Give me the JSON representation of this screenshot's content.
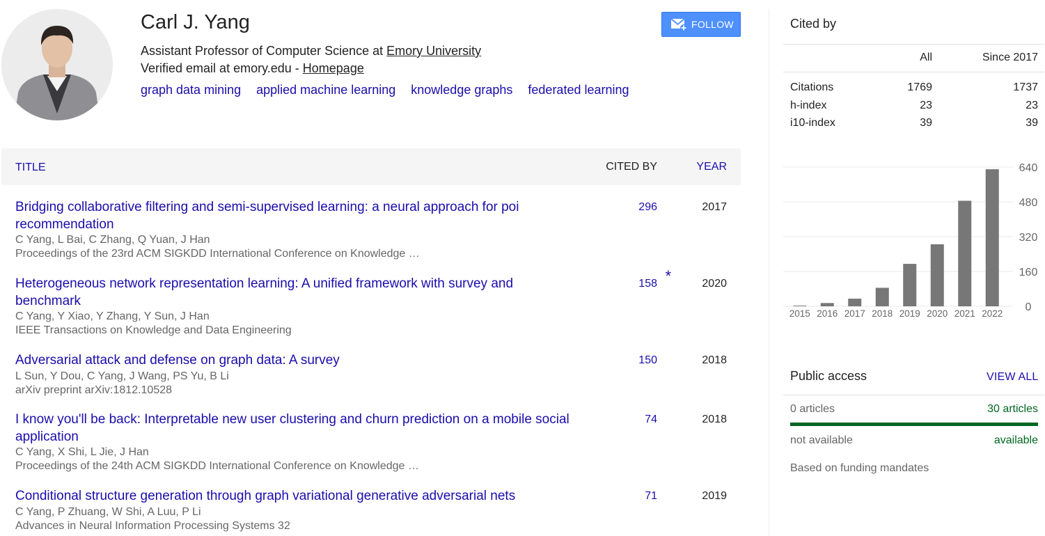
{
  "profile": {
    "name": "Carl J. Yang",
    "affiliation_prefix": "Assistant Professor of Computer Science at ",
    "affiliation_link": "Emory University",
    "email_prefix": "Verified email at emory.edu - ",
    "homepage_link": "Homepage",
    "interests": [
      "graph data mining",
      "applied machine learning",
      "knowledge graphs",
      "federated learning"
    ],
    "follow_label": "FOLLOW"
  },
  "table": {
    "col_title": "TITLE",
    "col_cited": "CITED BY",
    "col_year": "YEAR",
    "rows": [
      {
        "title": "Bridging collaborative filtering and semi-supervised learning: a neural approach for poi recommendation",
        "authors": "C Yang, L Bai, C Zhang, Q Yuan, J Han",
        "venue": "Proceedings of the 23rd ACM SIGKDD International Conference on Knowledge …",
        "cited": "296",
        "star": "",
        "year": "2017"
      },
      {
        "title": "Heterogeneous network representation learning: A unified framework with survey and benchmark",
        "authors": "C Yang, Y Xiao, Y Zhang, Y Sun, J Han",
        "venue": "IEEE Transactions on Knowledge and Data Engineering",
        "cited": "158",
        "star": "*",
        "year": "2020"
      },
      {
        "title": "Adversarial attack and defense on graph data: A survey",
        "authors": "L Sun, Y Dou, C Yang, J Wang, PS Yu, B Li",
        "venue": "arXiv preprint arXiv:1812.10528",
        "cited": "150",
        "star": "",
        "year": "2018"
      },
      {
        "title": "I know you'll be back: Interpretable new user clustering and churn prediction on a mobile social application",
        "authors": "C Yang, X Shi, L Jie, J Han",
        "venue": "Proceedings of the 24th ACM SIGKDD International Conference on Knowledge …",
        "cited": "74",
        "star": "",
        "year": "2018"
      },
      {
        "title": "Conditional structure generation through graph variational generative adversarial nets",
        "authors": "C Yang, P Zhuang, W Shi, A Luu, P Li",
        "venue": "Advances in Neural Information Processing Systems 32",
        "cited": "71",
        "star": "",
        "year": "2019"
      }
    ]
  },
  "cited_by": {
    "title": "Cited by",
    "col_all": "All",
    "col_since": "Since 2017",
    "rows": [
      {
        "label": "Citations",
        "all": "1769",
        "since": "1737"
      },
      {
        "label": "h-index",
        "all": "23",
        "since": "23"
      },
      {
        "label": "i10-index",
        "all": "39",
        "since": "39"
      }
    ]
  },
  "chart_data": {
    "type": "bar",
    "categories": [
      "2015",
      "2016",
      "2017",
      "2018",
      "2019",
      "2020",
      "2021",
      "2022"
    ],
    "values": [
      3,
      15,
      35,
      85,
      195,
      285,
      485,
      630
    ],
    "yticks": [
      "0",
      "160",
      "320",
      "480",
      "640"
    ],
    "ylim": [
      0,
      640
    ],
    "bar_color": "#777777",
    "grid": true
  },
  "public_access": {
    "title": "Public access",
    "view_all": "VIEW ALL",
    "left_count": "0 articles",
    "right_count": "30 articles",
    "left_status": "not available",
    "right_status": "available",
    "note": "Based on funding mandates"
  },
  "colors": {
    "link": "#1a0dab",
    "follow_button": "#4d90fe",
    "available": "#006621"
  }
}
